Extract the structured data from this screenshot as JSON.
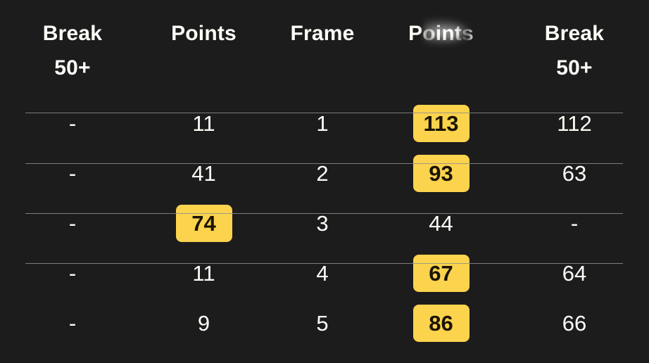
{
  "table": {
    "columns": [
      {
        "id": "break50-left",
        "title": "Break",
        "subtitle": "50+",
        "obscured": false
      },
      {
        "id": "points-left",
        "title": "Points",
        "subtitle": "",
        "obscured": false
      },
      {
        "id": "frame",
        "title": "Frame",
        "subtitle": "",
        "obscured": false
      },
      {
        "id": "points-right",
        "title": "Points",
        "subtitle": "",
        "obscured": true
      },
      {
        "id": "break50-right",
        "title": "Break",
        "subtitle": "50+",
        "obscured": false
      }
    ],
    "rows": [
      {
        "break_left": "-",
        "break_left_hl": false,
        "points_left": "11",
        "points_left_hl": false,
        "frame": "1",
        "points_right": "113",
        "points_right_hl": true,
        "break_right": "112",
        "break_right_hl": false,
        "divider_below": true
      },
      {
        "break_left": "-",
        "break_left_hl": false,
        "points_left": "41",
        "points_left_hl": false,
        "frame": "2",
        "points_right": "93",
        "points_right_hl": true,
        "break_right": "63",
        "break_right_hl": false,
        "divider_below": true
      },
      {
        "break_left": "-",
        "break_left_hl": false,
        "points_left": "74",
        "points_left_hl": true,
        "frame": "3",
        "points_right": "44",
        "points_right_hl": false,
        "break_right": "-",
        "break_right_hl": false,
        "divider_below": true
      },
      {
        "break_left": "-",
        "break_left_hl": false,
        "points_left": "11",
        "points_left_hl": false,
        "frame": "4",
        "points_right": "67",
        "points_right_hl": true,
        "break_right": "64",
        "break_right_hl": false,
        "divider_below": false
      },
      {
        "break_left": "-",
        "break_left_hl": false,
        "points_left": "9",
        "points_left_hl": false,
        "frame": "5",
        "points_right": "86",
        "points_right_hl": true,
        "break_right": "66",
        "break_right_hl": false,
        "divider_below": false
      }
    ]
  },
  "colors": {
    "background": "#1c1c1c",
    "text": "#fdfdf7",
    "highlight_background": "#fcd34d",
    "highlight_text": "#1a1400",
    "divider": "#8d8d8d"
  }
}
